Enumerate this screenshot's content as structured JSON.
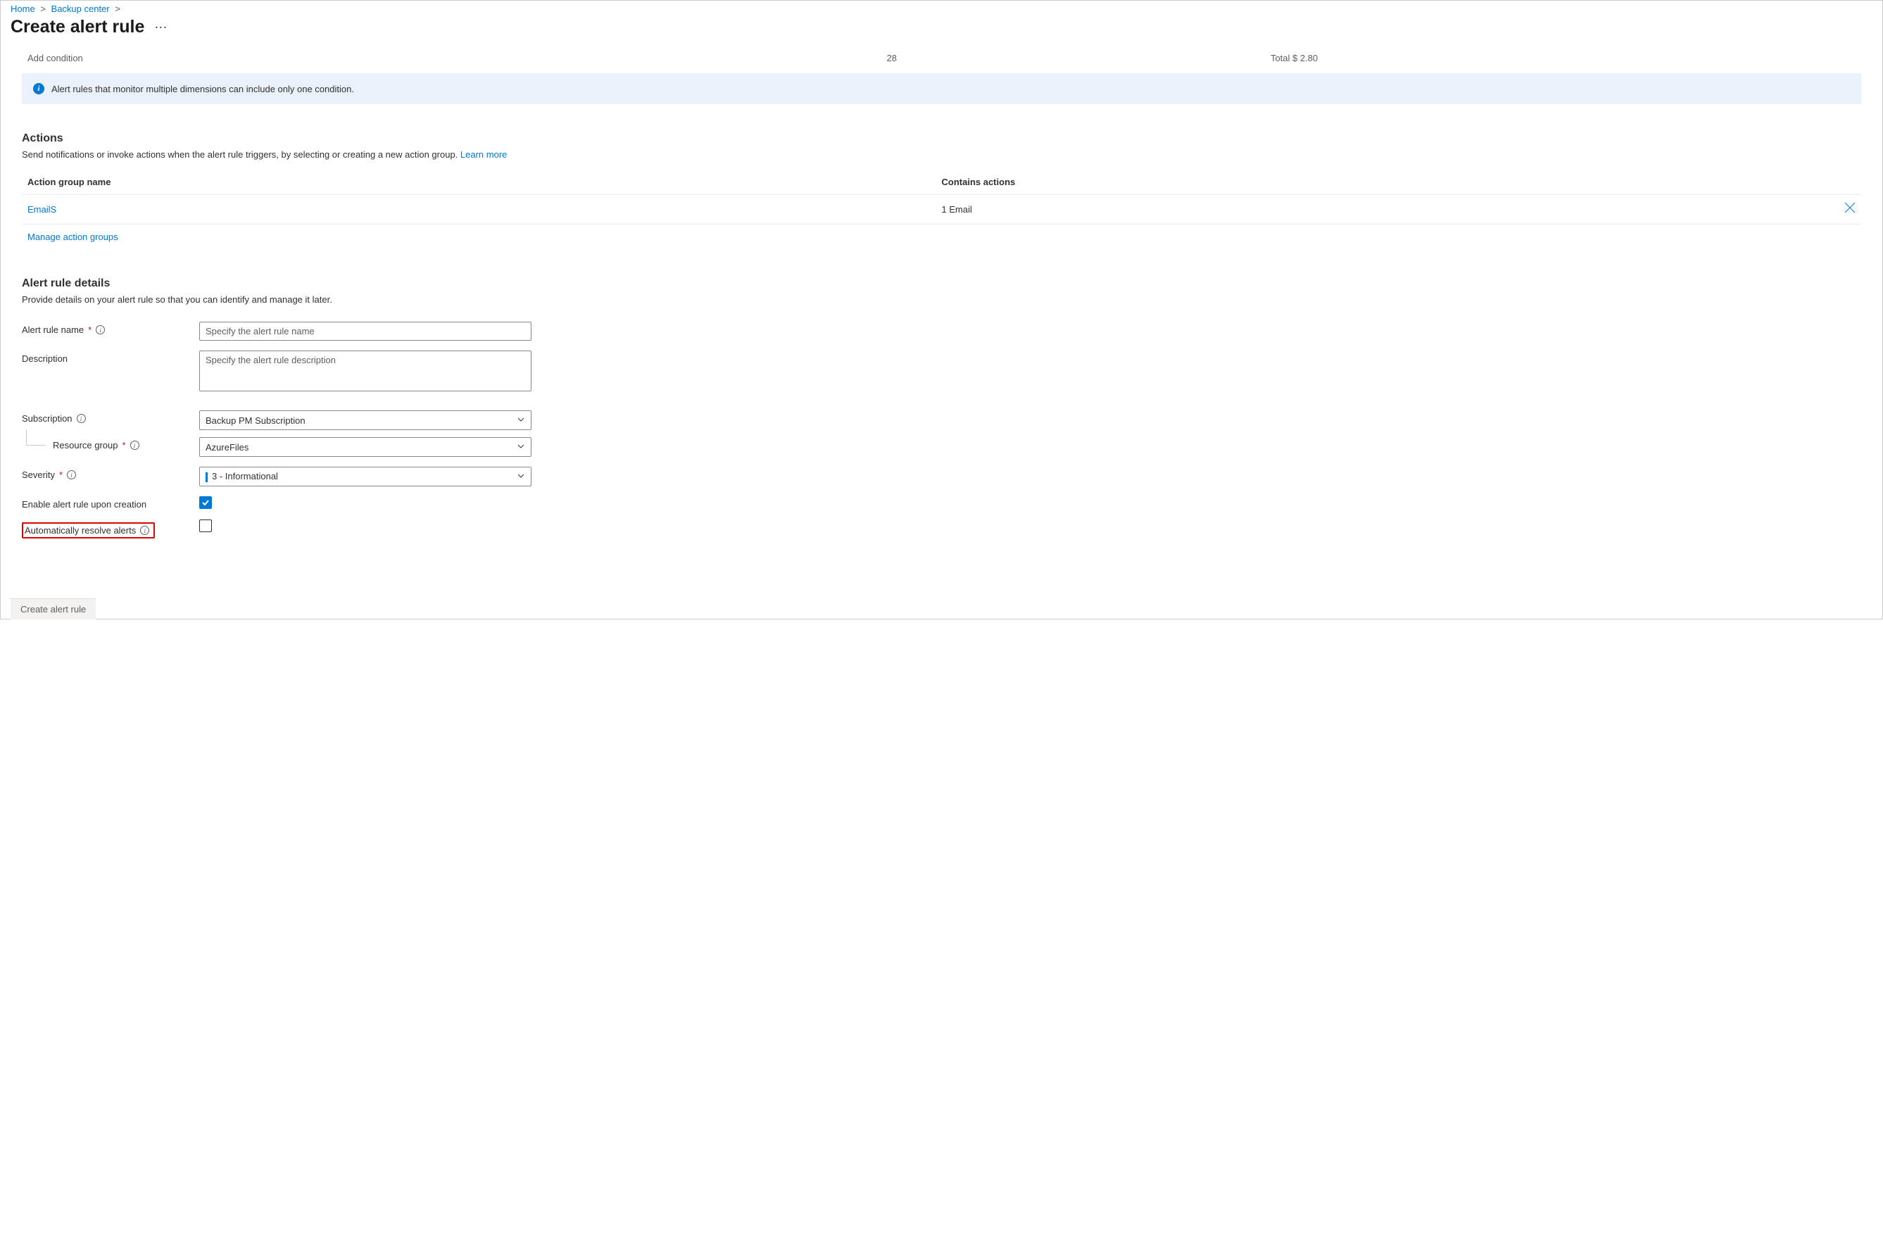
{
  "breadcrumb": {
    "home": "Home",
    "backup_center": "Backup center"
  },
  "page_title": "Create alert rule",
  "condition": {
    "add_label": "Add condition",
    "count": "28",
    "total": "Total $ 2.80"
  },
  "info_banner": "Alert rules that monitor multiple dimensions can include only one condition.",
  "actions": {
    "title": "Actions",
    "desc": "Send notifications or invoke actions when the alert rule triggers, by selecting or creating a new action group. ",
    "learn_more": "Learn more",
    "headers": {
      "name": "Action group name",
      "contains": "Contains actions"
    },
    "rows": [
      {
        "name": "EmailS",
        "contains": "1 Email"
      }
    ],
    "manage": "Manage action groups"
  },
  "details": {
    "title": "Alert rule details",
    "desc": "Provide details on your alert rule so that you can identify and manage it later.",
    "labels": {
      "name": "Alert rule name",
      "description": "Description",
      "subscription": "Subscription",
      "resource_group": "Resource group",
      "severity": "Severity",
      "enable": "Enable alert rule upon creation",
      "auto_resolve": "Automatically resolve alerts"
    },
    "placeholders": {
      "name": "Specify the alert rule name",
      "description": "Specify the alert rule description"
    },
    "values": {
      "subscription": "Backup PM Subscription",
      "resource_group": "AzureFiles",
      "severity": "3 - Informational",
      "enable_checked": true,
      "auto_resolve_checked": false
    }
  },
  "footer": {
    "create": "Create alert rule"
  }
}
